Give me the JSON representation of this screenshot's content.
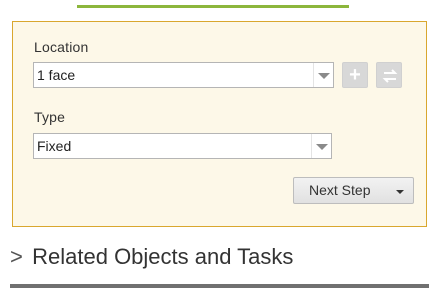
{
  "panel": {
    "location_label": "Location",
    "location_value": "1 face",
    "type_label": "Type",
    "type_value": "Fixed",
    "next_step_label": "Next Step",
    "add_icon": "plus-icon",
    "swap_icon": "swap-icon"
  },
  "related": {
    "chevron": ">",
    "title": "Related Objects and Tasks"
  },
  "colors": {
    "accent_green": "#8cb63c",
    "panel_border": "#d9a72e",
    "panel_background": "#fdf8e8",
    "disabled_button": "#d8d8d8"
  }
}
